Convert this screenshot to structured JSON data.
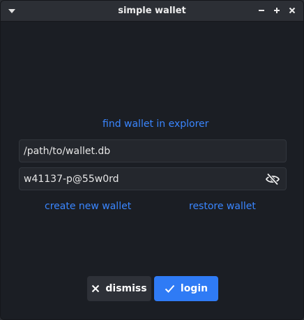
{
  "window": {
    "title": "simple wallet",
    "controls": [
      "minimize-icon",
      "maximize-icon",
      "close-icon"
    ]
  },
  "links": {
    "find_wallet": "find wallet in explorer",
    "create_wallet": "create new wallet",
    "restore_wallet": "restore wallet"
  },
  "wallet_path": {
    "value": "/path/to/wallet.db"
  },
  "password": {
    "value": "w41137-p@55w0rd",
    "visibility_icon": "eye-slash-icon"
  },
  "buttons": {
    "dismiss_label": "dismiss",
    "dismiss_icon": "x-icon",
    "login_label": "login",
    "login_icon": "check-icon"
  },
  "colors": {
    "accent": "#2f7bf5",
    "link": "#3a86ff",
    "background": "#1b1e24"
  }
}
